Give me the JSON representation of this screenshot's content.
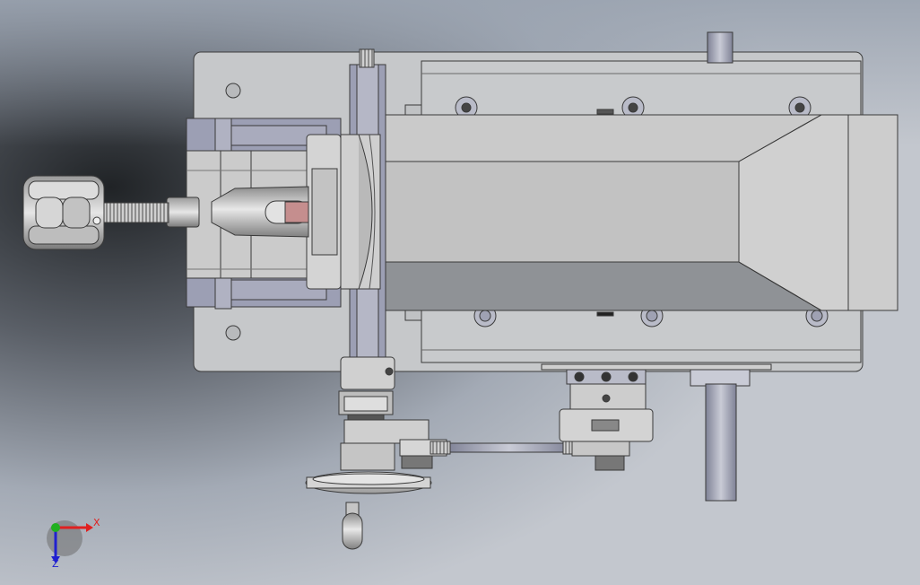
{
  "viewport": {
    "background_top": "#a7aeb9",
    "background_mid": "#4a4f56",
    "background_bottom": "#c2c6cd"
  },
  "model": {
    "part_color": "#c6c8ca",
    "part_dark": "#8f9296",
    "slot_color": "#9c9fb4",
    "edge_color": "#3a3a3a",
    "highlight_color": "#c58e8e"
  },
  "triad": {
    "x_label": "X",
    "z_label": "Z",
    "x_color": "#e02020",
    "y_color": "#20b020",
    "z_color": "#2020d0"
  }
}
